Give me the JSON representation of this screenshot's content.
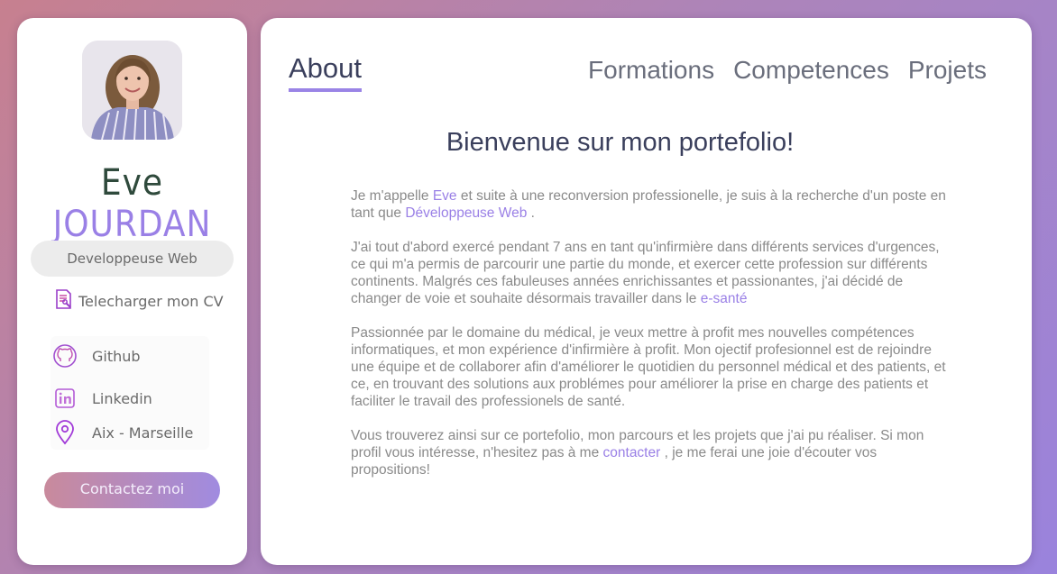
{
  "sidebar": {
    "first_name": "Eve",
    "last_name": "JOURDAN",
    "role": "Developpeuse Web",
    "cv_label": "Telecharger mon CV",
    "contacts": [
      {
        "label": "Github",
        "icon": "github-icon"
      },
      {
        "label": "Linkedin",
        "icon": "linkedin-icon"
      },
      {
        "label": "Aix - Marseille",
        "icon": "location-pin-icon"
      }
    ],
    "contact_button": "Contactez moi"
  },
  "nav": {
    "active": "About",
    "items": [
      "Formations",
      "Competences",
      "Projets"
    ]
  },
  "main": {
    "title": "Bienvenue sur mon portefolio!",
    "p1": {
      "a": "Je m'appelle ",
      "name": "Eve",
      "b": " et suite à une reconversion professionelle, je suis à la recherche d'un poste en tant que ",
      "job": "Développeuse Web",
      "c": " ."
    },
    "p2": {
      "a": "J'ai tout d'abord exercé pendant 7 ans en tant qu'infirmière dans différents services d'urgences, ce qui m'a permis de parcourir une partie du monde, et exercer cette profession sur différents continents. Malgrés ces fabuleuses années enrichissantes et passionantes, j'ai décidé de changer de voie et souhaite désormais travailler dans le ",
      "link": "e-santé"
    },
    "p3": "Passionnée par le domaine du médical, je veux mettre à profit mes nouvelles compétences informatiques, et mon expérience d'infirmière à profit. Mon ojectif profesionnel est de rejoindre une équipe et de collaborer afin d'améliorer le quotidien du personnel médical et des patients, et ce, en trouvant des solutions aux problémes pour améliorer la prise en charge des patients et faciliter le travail des professionels de santé.",
    "p4": {
      "a": "Vous trouverez ainsi sur ce portefolio, mon parcours et les projets que j'ai pu réaliser. Si mon profil vous intéresse, n'hesitez pas à me ",
      "link": "contacter",
      "b": " , je me ferai une joie d'écouter vos propositions!"
    }
  },
  "colors": {
    "accent": "#9a80e6",
    "text": "#8a8a8a",
    "heading": "#3a3f5c"
  }
}
